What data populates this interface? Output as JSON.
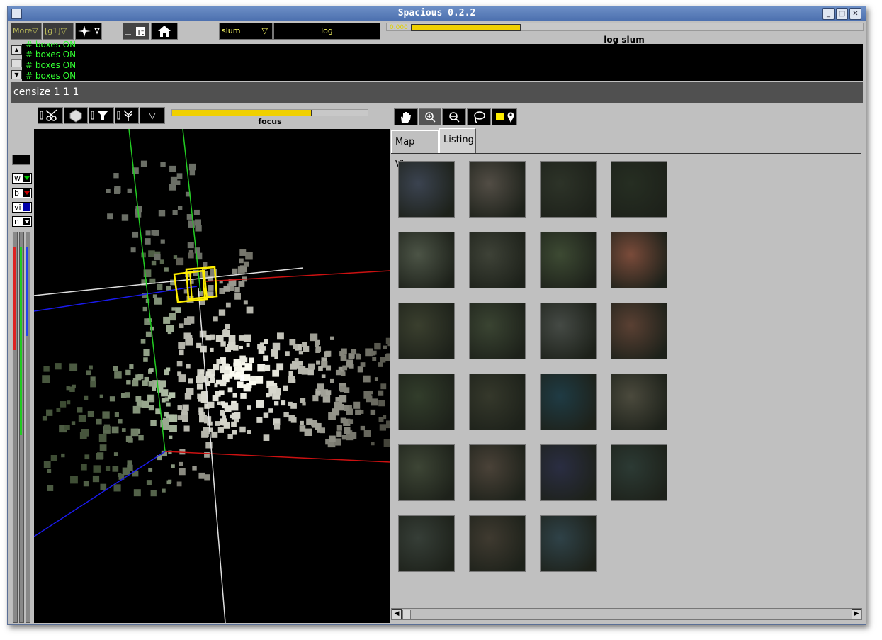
{
  "window": {
    "title": "Spacious 0.2.2"
  },
  "toolbar": {
    "more_label": "More",
    "group_label": "[g1]",
    "dropdown_arrow": "▽",
    "slum_label": "slum",
    "log_label": "log",
    "progress_value_text": "0.000",
    "progress_fraction": 0.24,
    "progress_title": "log slum"
  },
  "console": {
    "lines": [
      "# boxes ON",
      "# boxes ON",
      "# boxes ON",
      "# boxes ON"
    ]
  },
  "command_line": {
    "text": "censize  1 1 1"
  },
  "view3d": {
    "focus_label": "focus",
    "focus_fraction": 0.71,
    "channels": [
      {
        "label": "w",
        "color": "#00cc00"
      },
      {
        "label": "b",
        "color": "#cc0000"
      },
      {
        "label": "vi",
        "color": "#0000cc"
      },
      {
        "label": "n",
        "color": "#ffffff"
      }
    ],
    "bar_colors": [
      "#dd2222",
      "#22cc22",
      "#2244ee"
    ]
  },
  "listing": {
    "tabs": [
      "Map View",
      "Listing"
    ],
    "active_tab": "Listing",
    "thumb_colors": [
      [
        "#3b4350",
        "#524d45",
        "#2d3328",
        "#262e22"
      ],
      [
        "#4c5446",
        "#3e4237",
        "#3d4a33",
        "#7a4b3a"
      ],
      [
        "#3a3f2e",
        "#3a4432",
        "#454a45",
        "#5a4033"
      ],
      [
        "#323d2b",
        "#35382b",
        "#1f3b44",
        "#4b4a3d"
      ],
      [
        "#3d4535",
        "#4a4238",
        "#2a2d42",
        "#2c3a34"
      ],
      [
        "#363e37",
        "#3f3a30",
        "#2f4248"
      ]
    ]
  },
  "icons": {
    "hand": "hand-icon",
    "zoom_in": "zoom-in-icon",
    "zoom_out": "zoom-out-icon",
    "lasso": "lasso-icon",
    "pin": "pin-icon",
    "home": "home-icon"
  }
}
